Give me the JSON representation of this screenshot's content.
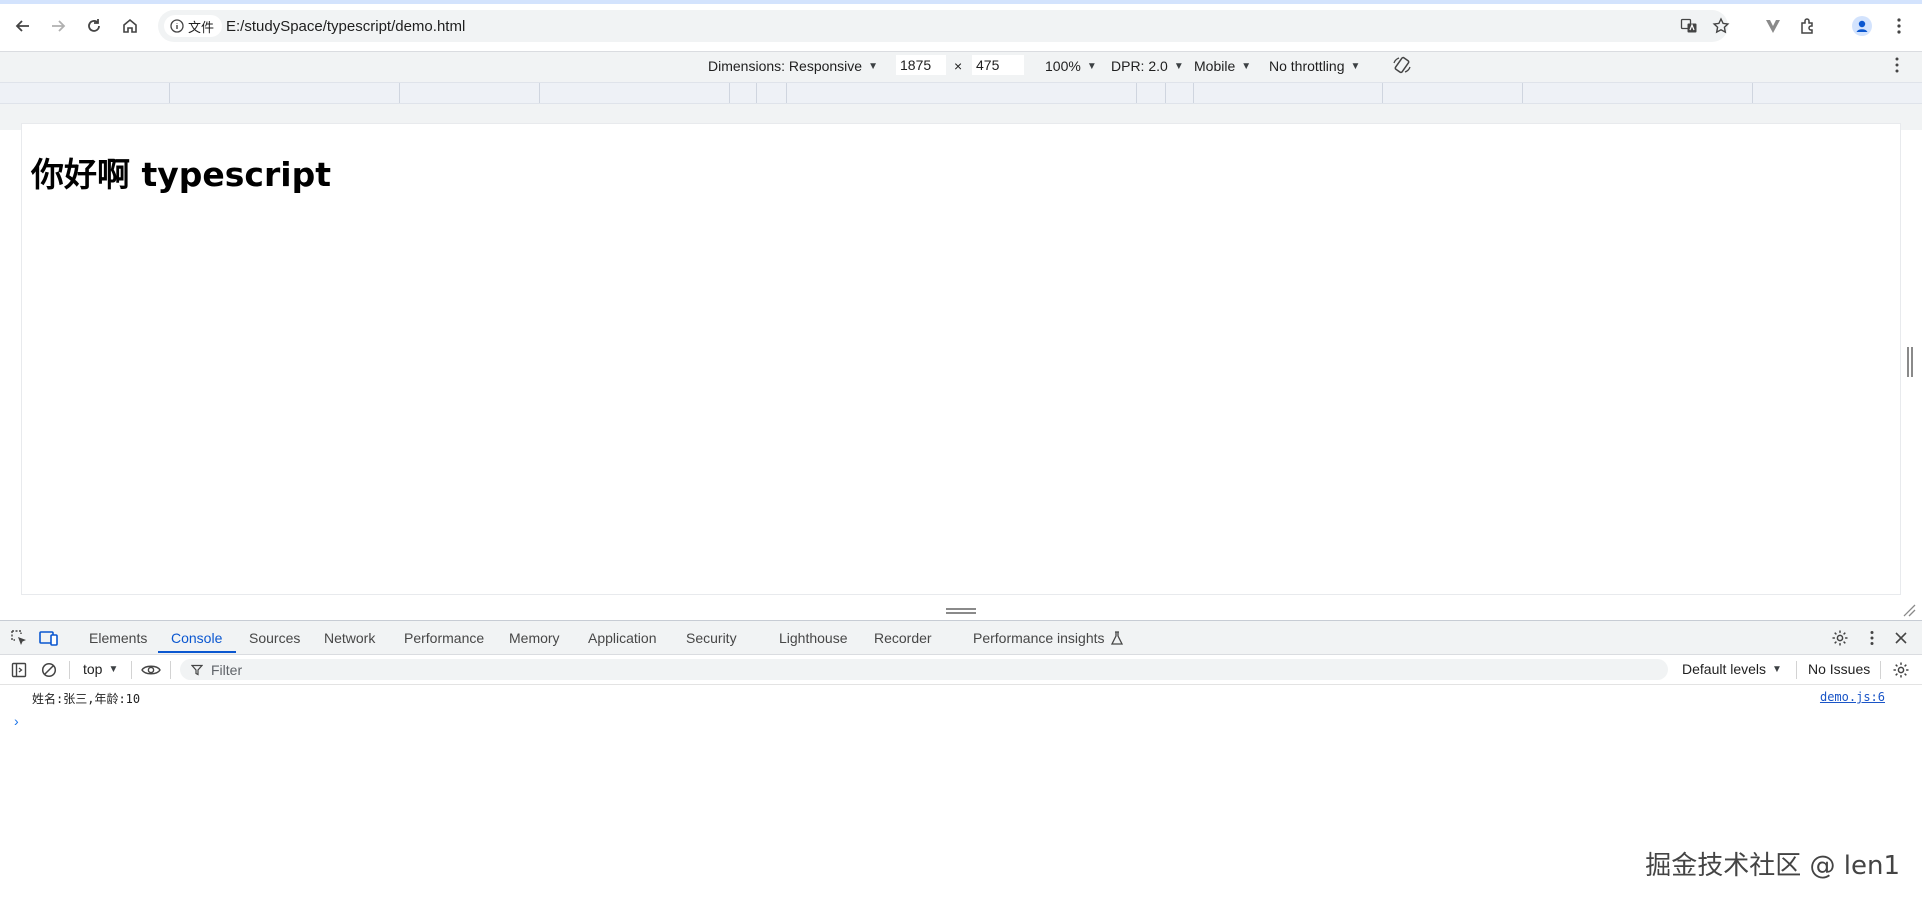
{
  "browser": {
    "site_chip_label": "文件",
    "url": "E:/studySpace/typescript/demo.html"
  },
  "device_toolbar": {
    "dimensions_label": "Dimensions: Responsive",
    "width": "1875",
    "times": "×",
    "height": "475",
    "zoom": "100%",
    "dpr": "DPR: 2.0",
    "device_type": "Mobile",
    "throttling": "No throttling"
  },
  "page": {
    "heading": "你好啊 typescript"
  },
  "devtools": {
    "tabs": [
      {
        "label": "Elements"
      },
      {
        "label": "Console"
      },
      {
        "label": "Sources"
      },
      {
        "label": "Network"
      },
      {
        "label": "Performance"
      },
      {
        "label": "Memory"
      },
      {
        "label": "Application"
      },
      {
        "label": "Security"
      },
      {
        "label": "Lighthouse"
      },
      {
        "label": "Recorder"
      },
      {
        "label": "Performance insights"
      }
    ],
    "active_tab": "Console",
    "context": "top",
    "filter_placeholder": "Filter",
    "levels": "Default levels",
    "issues": "No Issues",
    "log": {
      "message": "姓名:张三,年龄:10",
      "source": "demo.js:6"
    },
    "prompt_symbol": "›"
  },
  "watermark": "掘金技术社区 @ len1",
  "colors": {
    "accent": "#0b57d0",
    "toolbar_bg": "#f1f3f4"
  }
}
